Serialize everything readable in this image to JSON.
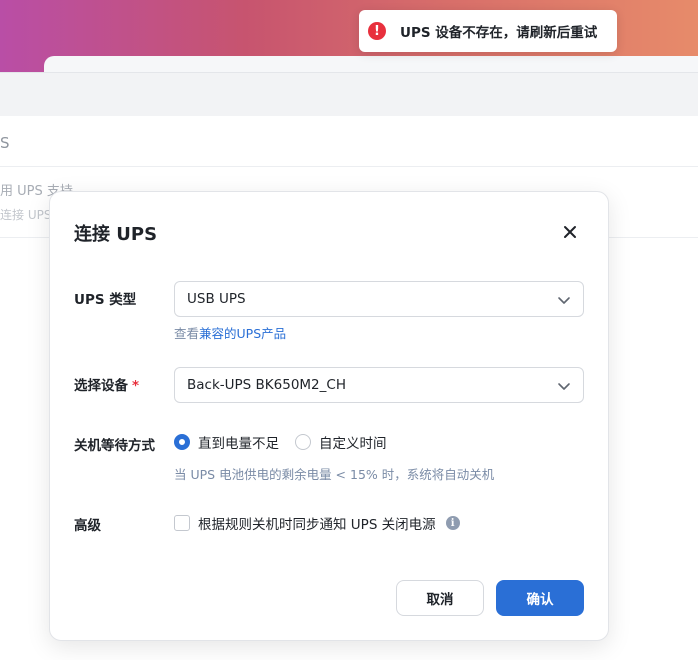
{
  "toast": {
    "message": "UPS 设备不存在，请刷新后重试",
    "icon": "error-icon",
    "icon_glyph": "!"
  },
  "background": {
    "section_title": "S",
    "enable_label": "用 UPS 支持",
    "enable_sub": "连接 UPS"
  },
  "dialog": {
    "title": "连接 UPS",
    "close_icon": "close-icon",
    "ups_type": {
      "label": "UPS 类型",
      "value": "USB UPS"
    },
    "compat_link": {
      "prefix": "查看",
      "text": "兼容的UPS产品"
    },
    "device": {
      "label": "选择设备",
      "required_mark": "*",
      "value": "Back-UPS BK650M2_CH"
    },
    "shutdown": {
      "label": "关机等待方式",
      "options": [
        {
          "label": "直到电量不足",
          "checked": true
        },
        {
          "label": "自定义时间",
          "checked": false
        }
      ],
      "hint": "当 UPS 电池供电的剩余电量 < 15% 时，系统将自动关机"
    },
    "advanced": {
      "label": "高级",
      "checkbox_label": "根据规则关机时同步通知 UPS 关闭电源",
      "checked": false,
      "info_glyph": "i"
    },
    "buttons": {
      "cancel": "取消",
      "ok": "确认"
    }
  },
  "colors": {
    "accent": "#2a6fd6",
    "error": "#e8303d"
  }
}
